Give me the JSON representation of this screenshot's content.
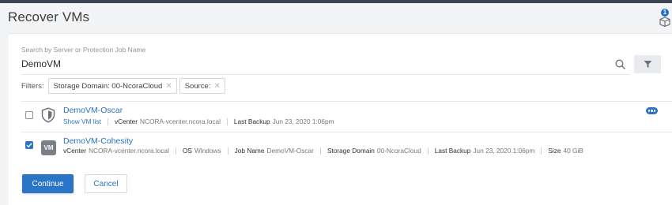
{
  "header": {
    "title": "Recover VMs",
    "notification_count": "1"
  },
  "search": {
    "label": "Search by Server or Protection Job Name",
    "value": "DemoVM"
  },
  "filters": {
    "label": "Filters:",
    "chips": [
      {
        "label": "Storage Domain: 00-NcoraCloud"
      },
      {
        "label": "Source:"
      }
    ]
  },
  "results": [
    {
      "title": "DemoVM-Oscar",
      "checked": false,
      "show_vm_list": "Show VM list",
      "vcenter_key": "vCenter",
      "vcenter_value": "NCORA-vcenter.ncora.local",
      "last_backup_key": "Last Backup",
      "last_backup_value": "Jun 23, 2020 1:06pm"
    },
    {
      "title": "DemoVM-Cohesity",
      "checked": true,
      "icon_text": "VM",
      "vcenter_key": "vCenter",
      "vcenter_value": "NCORA-vcenter.ncora.local",
      "os_key": "OS",
      "os_value": "Windows",
      "job_name_key": "Job Name",
      "job_name_value": "DemoVM-Oscar",
      "storage_domain_key": "Storage Domain",
      "storage_domain_value": "00-NcoraCloud",
      "last_backup_key": "Last Backup",
      "last_backup_value": "Jun 23, 2020 1:06pm",
      "size_key": "Size",
      "size_value": "40 GiB"
    }
  ],
  "actions": {
    "continue_label": "Continue",
    "cancel_label": "Cancel"
  },
  "colors": {
    "accent": "#2a75c8",
    "link": "#2c74c2",
    "topbar": "#3b4450"
  }
}
